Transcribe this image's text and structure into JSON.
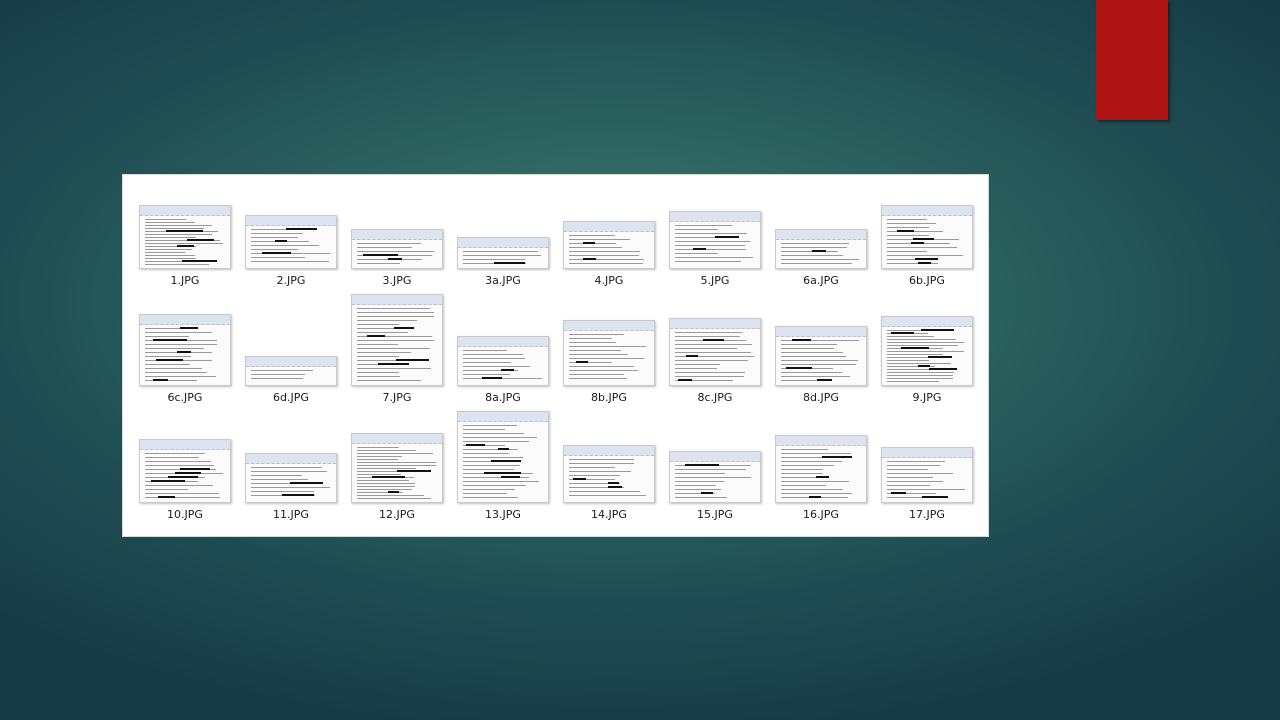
{
  "accent_color": "#b01515",
  "files": [
    {
      "name": "1.JPG",
      "kind": "dense"
    },
    {
      "name": "2.JPG",
      "kind": "medium"
    },
    {
      "name": "3.JPG",
      "kind": "short"
    },
    {
      "name": "3a.JPG",
      "kind": "short"
    },
    {
      "name": "4.JPG",
      "kind": "medium"
    },
    {
      "name": "5.JPG",
      "kind": "medium"
    },
    {
      "name": "6a.JPG",
      "kind": "short"
    },
    {
      "name": "6b.JPG",
      "kind": "medium"
    },
    {
      "name": "6c.JPG",
      "kind": "medium"
    },
    {
      "name": "6d.JPG",
      "kind": "short"
    },
    {
      "name": "7.JPG",
      "kind": "tall"
    },
    {
      "name": "8a.JPG",
      "kind": "medium"
    },
    {
      "name": "8b.JPG",
      "kind": "medium"
    },
    {
      "name": "8c.JPG",
      "kind": "medium"
    },
    {
      "name": "8d.JPG",
      "kind": "medium"
    },
    {
      "name": "9.JPG",
      "kind": "dense"
    },
    {
      "name": "10.JPG",
      "kind": "medium"
    },
    {
      "name": "11.JPG",
      "kind": "short"
    },
    {
      "name": "12.JPG",
      "kind": "dense"
    },
    {
      "name": "13.JPG",
      "kind": "tall"
    },
    {
      "name": "14.JPG",
      "kind": "medium"
    },
    {
      "name": "15.JPG",
      "kind": "short"
    },
    {
      "name": "16.JPG",
      "kind": "medium"
    },
    {
      "name": "17.JPG",
      "kind": "medium"
    }
  ]
}
